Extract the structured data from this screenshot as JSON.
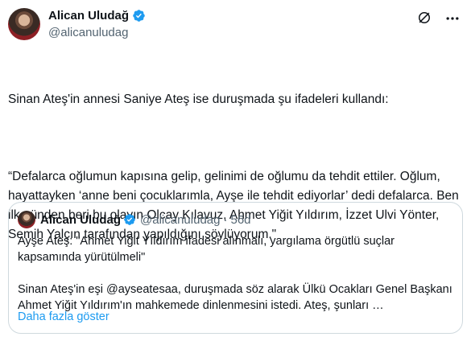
{
  "author": {
    "name": "Alican Uludağ",
    "handle": "@alicanuludag"
  },
  "tweet": {
    "paragraphs": [
      "Sinan Ateş'in annesi Saniye Ateş ise duruşmada şu ifadeleri kullandı:",
      "“Defalarca oğlumun kapısına gelip, gelinimi de oğlumu da tehdit ettiler. Oğlum, hayattayken ‘anne beni çocuklarımla, Ayşe ile tehdit ediyorlar’ dedi defalarca. Ben ilk günden beri bu olayın Olcay Kılavuz, Ahmet Yiğit Yıldırım, İzzet Ulvi Yönter, Semih Yalçın tarafından yapıldığını söylüyorum.\""
    ]
  },
  "quote": {
    "name": "Alican Uludağ",
    "handle": "@alicanuludag",
    "dot": "·",
    "time": "56d",
    "paragraphs": [
      "Ayşe Ateş: \"Ahmet Yiğit Yıldırım ifadesi alınmalı, yargılama örgütlü suçlar kapsamında yürütülmeli\"",
      "Sinan Ateş'in eşi @ayseatesaa, duruşmada söz alarak Ülkü Ocakları Genel Başkanı Ahmet Yiğit Yıldırım'ın mahkemede dinlenmesini istedi. Ateş, şunları …"
    ],
    "show_more": "Daha fazla göster"
  },
  "colors": {
    "verified": "#1d9bf0",
    "link": "#1d9bf0",
    "secondary_text": "#536471",
    "border": "#cfd9de"
  },
  "icons": [
    "verified-badge-icon",
    "grok-icon",
    "more-options-icon"
  ]
}
